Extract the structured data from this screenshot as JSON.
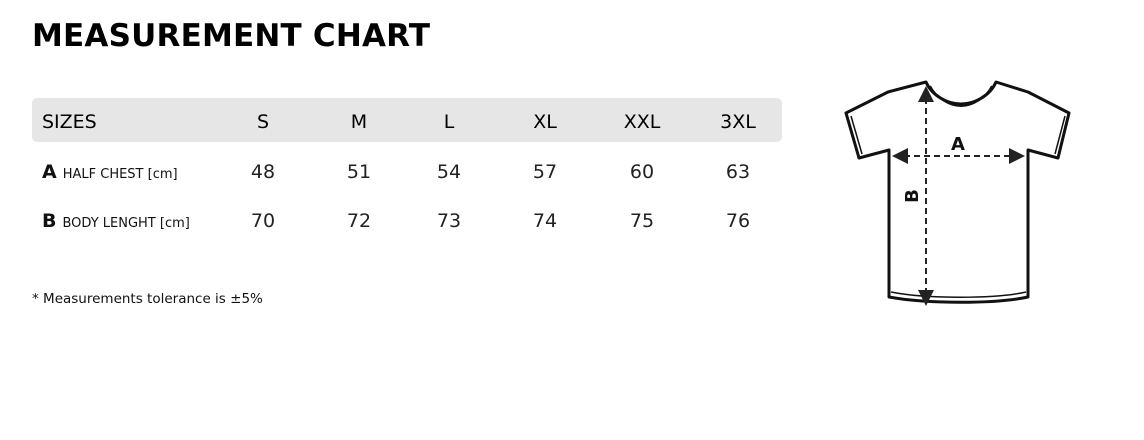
{
  "title": "MEASUREMENT CHART",
  "table": {
    "header_label": "SIZES",
    "sizes": [
      "S",
      "M",
      "L",
      "XL",
      "XXL",
      "3XL"
    ],
    "rows": [
      {
        "letter": "A",
        "label": "HALF CHEST [cm]",
        "values": [
          "48",
          "51",
          "54",
          "57",
          "60",
          "63"
        ]
      },
      {
        "letter": "B",
        "label": "BODY LENGHT [cm]",
        "values": [
          "70",
          "72",
          "73",
          "74",
          "75",
          "76"
        ]
      }
    ]
  },
  "note": "* Measurements tolerance is ±5%",
  "diagram": {
    "label_a": "A",
    "label_b": "B",
    "icon": "tshirt-icon"
  },
  "colors": {
    "header_bg": "#e6e6e6",
    "text": "#111111"
  }
}
